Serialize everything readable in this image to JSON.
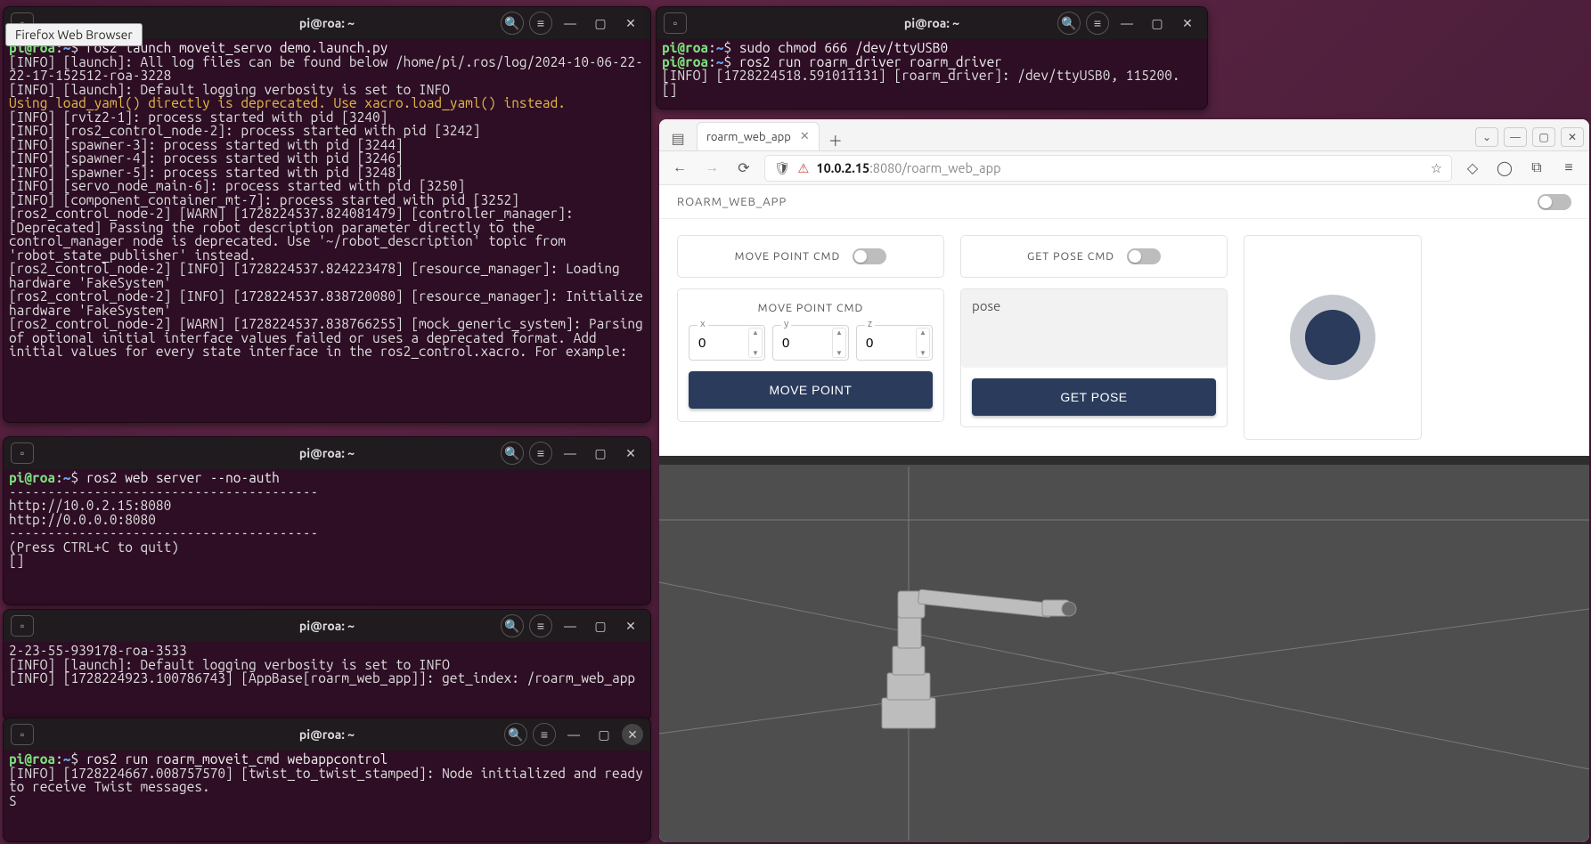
{
  "tooltip": "Firefox Web Browser",
  "terminals": {
    "t1": {
      "title": "pi@roa: ~",
      "prompt_user": "pi@roa",
      "prompt_path": "~",
      "cmd": "ros2 launch moveit_servo demo.launch.py",
      "lines": [
        "[INFO] [launch]: All log files can be found below /home/pi/.ros/log/2024-10-06-22-22-17-152512-roa-3228",
        "[INFO] [launch]: Default logging verbosity is set to INFO"
      ],
      "warn": "Using load_yaml() directly is deprecated. Use xacro.load_yaml() instead.",
      "lines2": [
        "[INFO] [rviz2-1]: process started with pid [3240]",
        "[INFO] [ros2_control_node-2]: process started with pid [3242]",
        "[INFO] [spawner-3]: process started with pid [3244]",
        "[INFO] [spawner-4]: process started with pid [3246]",
        "[INFO] [spawner-5]: process started with pid [3248]",
        "[INFO] [servo_node_main-6]: process started with pid [3250]",
        "[INFO] [component_container_mt-7]: process started with pid [3252]",
        "[ros2_control_node-2] [WARN] [1728224537.824081479] [controller_manager]: [Deprecated] Passing the robot description parameter directly to the control_manager node is deprecated. Use '~/robot_description' topic from 'robot_state_publisher' instead.",
        "[ros2_control_node-2] [INFO] [1728224537.824223478] [resource_manager]: Loading hardware 'FakeSystem'",
        "[ros2_control_node-2] [INFO] [1728224537.838720080] [resource_manager]: Initialize hardware 'FakeSystem'",
        "[ros2_control_node-2] [WARN] [1728224537.838766255] [mock_generic_system]: Parsing of optional initial interface values failed or uses a deprecated format. Add initial values for every state interface in the ros2_control.xacro. For example:"
      ]
    },
    "t2": {
      "title": "pi@roa: ~",
      "prompt_user": "pi@roa",
      "prompt_path": "~",
      "cmd": "ros2 web server --no-auth",
      "lines": [
        "----------------------------------------",
        "http://10.0.2.15:8080",
        "http://0.0.0.0:8080",
        "----------------------------------------",
        "(Press CTRL+C to quit)",
        "[]"
      ]
    },
    "t3": {
      "title": "pi@roa: ~",
      "body_raw": "2-23-55-939178-roa-3533\n[INFO] [launch]: Default logging verbosity is set to INFO\n[INFO] [1728224923.100786743] [AppBase[roarm_web_app]]: get_index: /roarm_web_app"
    },
    "t4": {
      "title": "pi@roa: ~",
      "prompt_user": "pi@roa",
      "prompt_path": "~",
      "cmd": "ros2 run roarm_moveit_cmd webappcontrol",
      "lines": [
        "[INFO] [1728224667.008757570] [twist_to_twist_stamped]: Node initialized and ready to receive Twist messages.",
        "S"
      ]
    },
    "t5": {
      "title": "pi@roa: ~",
      "prompt_user": "pi@roa",
      "prompt_path": "~",
      "cmd1": "sudo chmod 666 /dev/ttyUSB0",
      "cmd2": "ros2 run roarm_driver roarm_driver",
      "lines": [
        "[INFO] [1728224518.591011131] [roarm_driver]: /dev/ttyUSB0, 115200.",
        "[]"
      ]
    }
  },
  "browser": {
    "tab_title": "roarm_web_app",
    "url_host": "10.0.2.15",
    "url_port": ":8080",
    "url_path": "/roarm_web_app",
    "app_title": "ROARM_WEB_APP",
    "card_move_title": "MOVE POINT CMD",
    "card_getpose_title": "GET POSE CMD",
    "card_move_form_title": "MOVE POINT CMD",
    "x_label": "x",
    "y_label": "y",
    "z_label": "z",
    "x_val": "0",
    "y_val": "0",
    "z_val": "0",
    "btn_move": "MOVE POINT",
    "pose_placeholder": "pose",
    "btn_getpose": "GET POSE"
  }
}
